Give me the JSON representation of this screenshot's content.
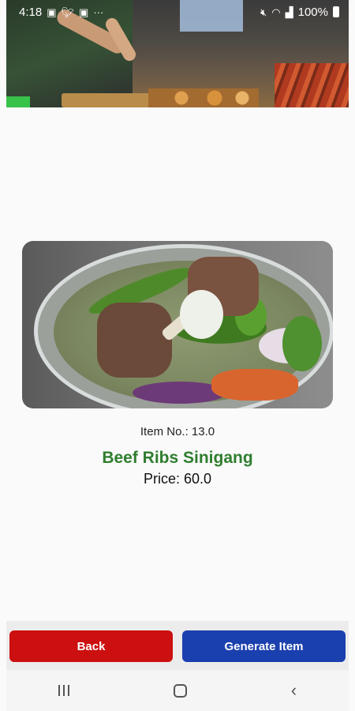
{
  "status_bar": {
    "time": "4:18",
    "battery": "100%",
    "left_icons": [
      "gallery-icon",
      "twitter-icon",
      "gallery-icon",
      "more-icon"
    ],
    "right_icons": [
      "mute-icon",
      "wifi-icon",
      "signal-icon",
      "battery-icon"
    ]
  },
  "item": {
    "number_label": "Item No.: 13.0",
    "name": "Beef Ribs Sinigang",
    "price_label": "Price: 60.0"
  },
  "buttons": {
    "back": "Back",
    "generate": "Generate Item"
  },
  "colors": {
    "name_green": "#2f7d2f",
    "back_red": "#cc0f0f",
    "generate_blue": "#1a3fae"
  }
}
